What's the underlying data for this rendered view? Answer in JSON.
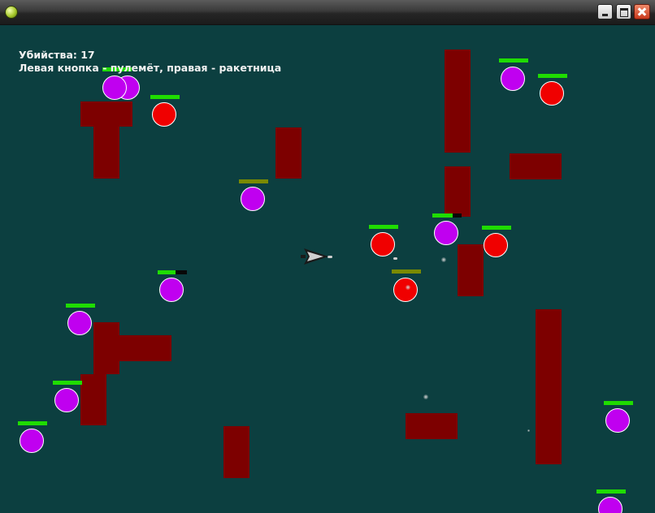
{
  "hud": {
    "kills_label": "Убийства: 17",
    "help_text": "Левая кнопка - пулемёт, правая - ракетница"
  },
  "colors": {
    "background": "#0c3f40",
    "wall": "#7d0000",
    "enemy_red": "#f00000",
    "enemy_purple": "#c000f0",
    "health_full": "#1fdc00",
    "health_low": "#7a8a00"
  },
  "enemies": [
    {
      "kind": "purple",
      "health": 1.0
    },
    {
      "kind": "purple",
      "health": 1.0
    },
    {
      "kind": "red",
      "health": 1.0
    },
    {
      "kind": "purple",
      "health": 1.0
    },
    {
      "kind": "red",
      "health": 1.0
    },
    {
      "kind": "purple",
      "health": 0.7
    },
    {
      "kind": "purple",
      "health": 1.0
    },
    {
      "kind": "red",
      "health": 1.0
    },
    {
      "kind": "red",
      "health": 1.0
    },
    {
      "kind": "red",
      "health": 0.6
    },
    {
      "kind": "purple",
      "health": 1.0
    },
    {
      "kind": "purple",
      "health": 1.0
    },
    {
      "kind": "purple",
      "health": 1.0
    },
    {
      "kind": "purple",
      "health": 1.0
    },
    {
      "kind": "purple",
      "health": 1.0
    },
    {
      "kind": "purple",
      "health": 1.0
    }
  ]
}
